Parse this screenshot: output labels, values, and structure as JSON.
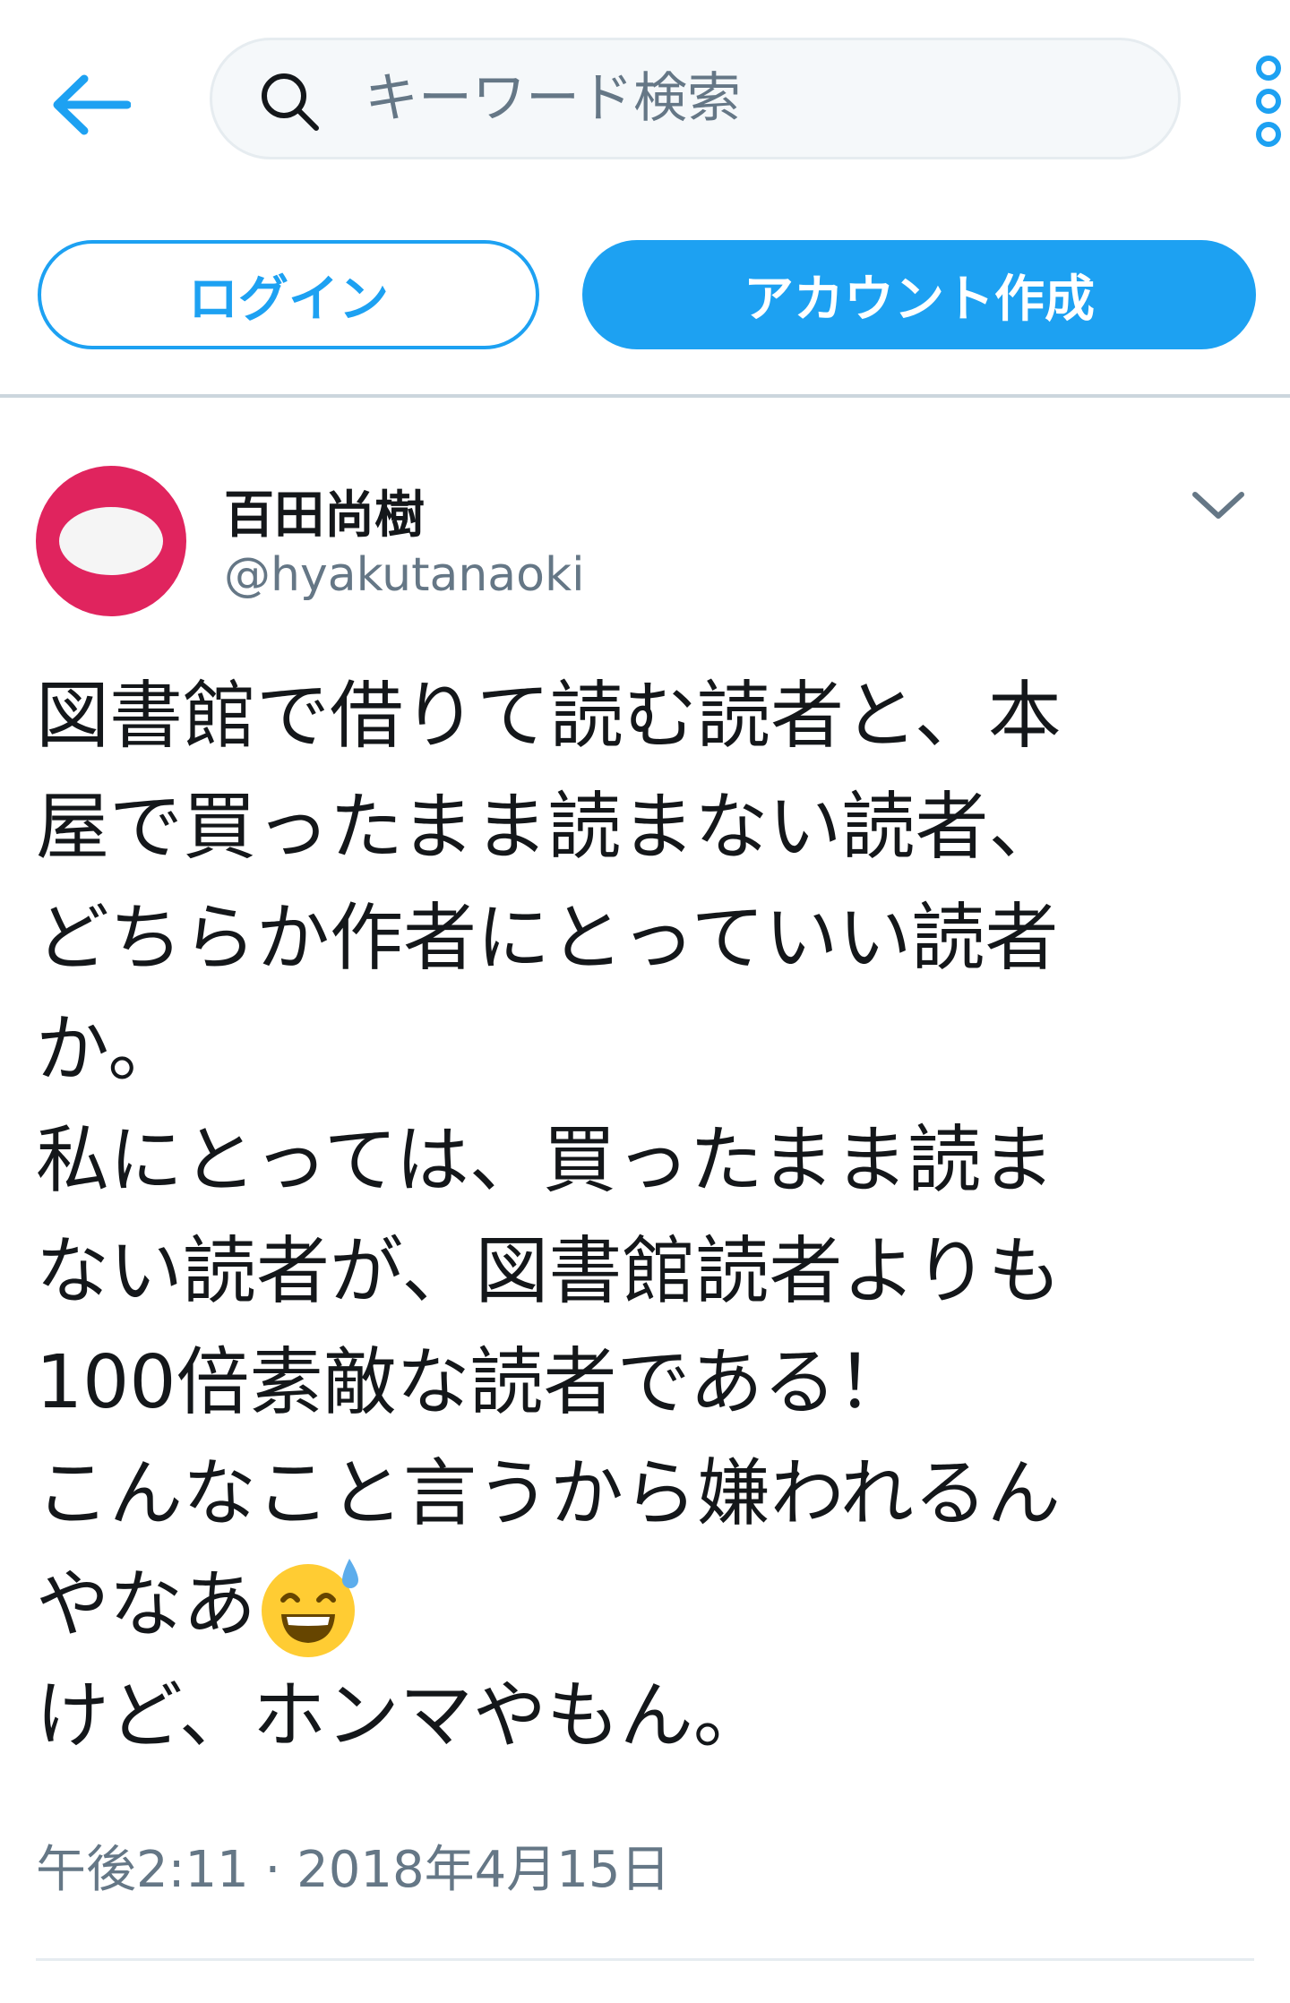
{
  "topbar": {
    "back_icon": "arrow-left-icon",
    "search_placeholder": "キーワード検索",
    "search_value": "",
    "search_icon": "search-icon",
    "more_icon": "more-vertical-icon"
  },
  "auth": {
    "login_label": "ログイン",
    "signup_label": "アカウント作成"
  },
  "tweet": {
    "author_name": "百田尚樹",
    "author_handle": "@hyakutanaoki",
    "avatar_icon": "avatar-icon",
    "menu_icon": "chevron-down-icon",
    "lines": [
      "図書館で借りて読む読者と、本",
      "屋で買ったまま読まない読者、",
      "どちらか作者にとっていい読者",
      "か。",
      "私にとっては、買ったまま読ま",
      "ない読者が、図書館読者よりも",
      "100倍素敵な読者である！",
      "こんなこと言うから嫌われるん",
      "やなあ",
      "けど、ホンマやもん。"
    ],
    "emoji_icon": "grinning-face-with-sweat-icon",
    "timestamp": "午後2:11 · 2018年4月15日"
  },
  "colors": {
    "brand_blue": "#1da1f2",
    "text_primary": "#14171a",
    "text_secondary": "#657786",
    "avatar_red": "#e0245e",
    "divider": "#ccd6dd"
  }
}
